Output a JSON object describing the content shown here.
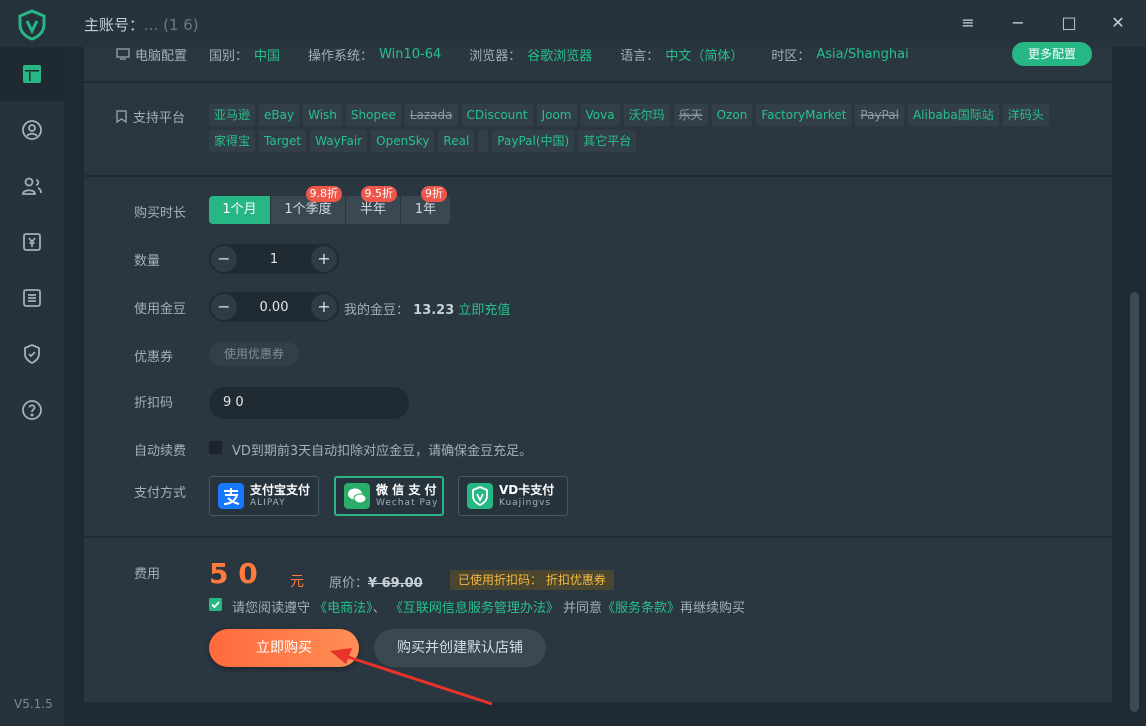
{
  "window": {
    "title_prefix": "主账号：",
    "title_masked": "... (1          6)",
    "controls": [
      "≡",
      "−",
      "□",
      "✕"
    ]
  },
  "sidebar": {
    "icons": [
      "dashboard-icon",
      "user-circle-icon",
      "users-icon",
      "yuan-icon",
      "list-icon",
      "shield-check-icon",
      "help-icon"
    ],
    "version": "V5.1.5"
  },
  "config": {
    "title": "电脑配置",
    "items": [
      {
        "label": "国别：",
        "value": "中国"
      },
      {
        "label": "操作系统：",
        "value": "Win10-64"
      },
      {
        "label": "浏览器：",
        "value": "谷歌浏览器"
      },
      {
        "label": "语言：",
        "value": "中文（简体）"
      },
      {
        "label": "时区：",
        "value": "Asia/Shanghai"
      }
    ],
    "more_button": "更多配置"
  },
  "platforms": {
    "title": "支持平台",
    "tags": [
      {
        "name": "亚马逊",
        "strike": false
      },
      {
        "name": "eBay",
        "strike": false
      },
      {
        "name": "Wish",
        "strike": false
      },
      {
        "name": "Shopee",
        "strike": false
      },
      {
        "name": "Lazada",
        "strike": true
      },
      {
        "name": "CDiscount",
        "strike": false
      },
      {
        "name": "Joom",
        "strike": false
      },
      {
        "name": "Vova",
        "strike": false
      },
      {
        "name": "沃尔玛",
        "strike": false
      },
      {
        "name": "乐天",
        "strike": true
      },
      {
        "name": "Ozon",
        "strike": false
      },
      {
        "name": "FactoryMarket",
        "strike": false
      },
      {
        "name": "PayPal",
        "strike": true
      },
      {
        "name": "Alibaba国际站",
        "strike": false
      },
      {
        "name": "洋码头",
        "strike": false
      },
      {
        "name": "家得宝",
        "strike": false
      },
      {
        "name": "Target",
        "strike": false
      },
      {
        "name": "WayFair",
        "strike": false
      },
      {
        "name": "OpenSky",
        "strike": false
      },
      {
        "name": "Real",
        "strike": false
      },
      {
        "name": " ",
        "strike": false
      },
      {
        "name": "PayPal(中国)",
        "strike": false
      },
      {
        "name": "其它平台",
        "strike": false
      }
    ]
  },
  "purchase": {
    "duration_label": "购买时长",
    "durations": [
      {
        "label": "1个月",
        "badge": "",
        "active": true
      },
      {
        "label": "1个季度",
        "badge": "9.8折",
        "active": false
      },
      {
        "label": "半年",
        "badge": "9.5折",
        "active": false
      },
      {
        "label": "1年",
        "badge": "9折",
        "active": false
      }
    ],
    "quantity_label": "数量",
    "quantity": "1",
    "beans_label": "使用金豆",
    "beans_value": "0.00",
    "my_beans_label": "我的金豆：",
    "my_beans_value": "13.23",
    "recharge_link": "立即充值",
    "coupon_label": "优惠券",
    "coupon_button": "使用优惠券",
    "code_label": "折扣码",
    "code_value": "9      0",
    "auto_renew_label": "自动续费",
    "auto_renew_text": "VD到期前3天自动扣除对应金豆，请确保金豆充足。",
    "pay_label": "支付方式",
    "pay_methods": [
      {
        "name": "支付宝支付",
        "sub": "ALIPAY",
        "selected": false,
        "color": "#1677ff"
      },
      {
        "name": "微 信 支 付",
        "sub": "Wechat Pay",
        "selected": true,
        "color": "#2aae67"
      },
      {
        "name": "VD卡支付",
        "sub": "Kuajingvs",
        "selected": false,
        "color": "#27b784"
      }
    ]
  },
  "fee": {
    "label": "费用",
    "amount": "5    0",
    "unit": "元",
    "original_label": "原价：",
    "original_value": "¥ 69.00",
    "used_code": "已使用折扣码：           折扣优惠券",
    "agree_text_1": "请您阅读遵守",
    "law_1": "《电商法》",
    "sep": "、",
    "law_2": "《互联网信息服务管理办法》",
    "agree_text_2": "并同意",
    "terms": "《服务条款》",
    "agree_text_3": "再继续购买",
    "buy_button": "立即购买",
    "buy_create_button": "购买并创建默认店铺"
  },
  "colors": {
    "accent": "#27b784",
    "orange": "#ff7a3d",
    "panel": "#2a3640",
    "bg": "#1f2a33"
  }
}
